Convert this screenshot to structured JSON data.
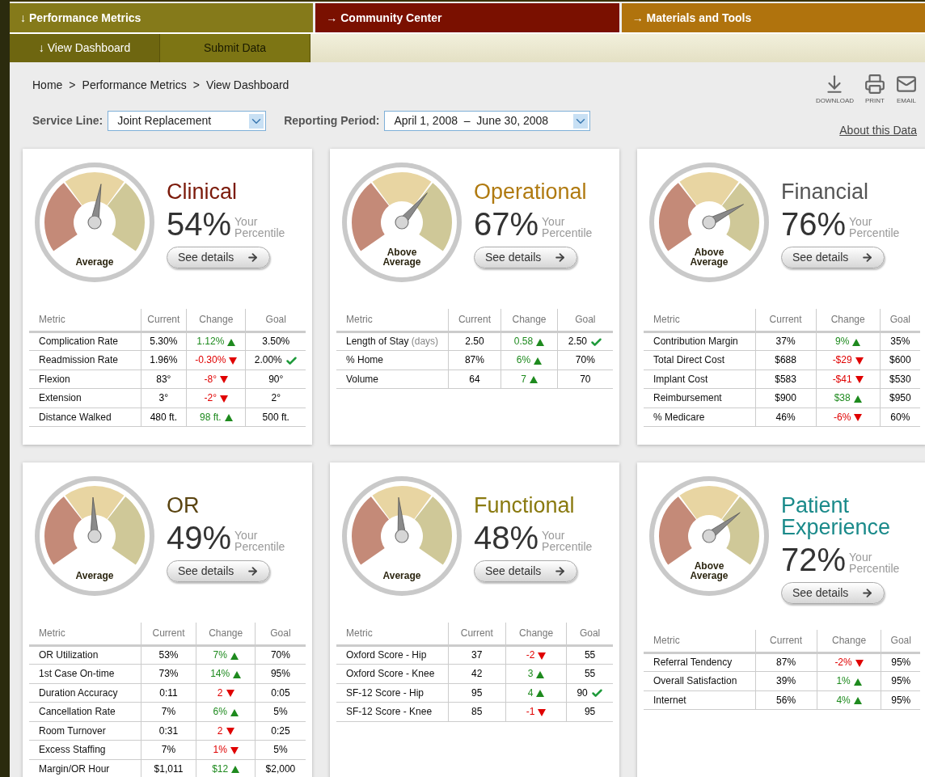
{
  "nav": {
    "tabs": [
      {
        "label": "↓ Performance Metrics",
        "color": "#857a1a"
      },
      {
        "label": "→ Community Center",
        "color": "#7a1000"
      },
      {
        "label": "→ Materials and Tools",
        "color": "#b0730d"
      }
    ],
    "subtabs": [
      {
        "label": "↓ View Dashboard",
        "selected": true
      },
      {
        "label": "Submit Data",
        "selected": false
      }
    ]
  },
  "breadcrumb": {
    "items": [
      "Home",
      "Performance Metrics",
      "View Dashboard"
    ],
    "separator": ">"
  },
  "tools": [
    {
      "kind": "download",
      "label": "DOWNLOAD"
    },
    {
      "kind": "print",
      "label": "PRINT"
    },
    {
      "kind": "email",
      "label": "EMAIL"
    }
  ],
  "filters": [
    {
      "label": "Service Line:",
      "value": "Joint Replacement"
    },
    {
      "label": "Reporting Period:",
      "value": "April 1, 2008  –  June 30, 2008"
    }
  ],
  "about_link": "About this Data",
  "cards": [
    {
      "title": "Clinical",
      "color": "#7b1a0a",
      "percent": "54%",
      "percentile_label": "Your Percentile",
      "level": 0.54,
      "rating": "Average",
      "button": "See details",
      "columns": [
        "Metric",
        "Current",
        "Change",
        "Goal"
      ],
      "rows": [
        {
          "metric": "Complication Rate",
          "current": "5.30%",
          "change": "1.12%",
          "kind": "up",
          "goal": "3.50%",
          "goal_met": false
        },
        {
          "metric": "Readmission Rate",
          "current": "1.96%",
          "change": "-0.30%",
          "kind": "down",
          "goal": "2.00%",
          "goal_met": true
        },
        {
          "metric": "Flexion",
          "current": "83°",
          "change": "-8°",
          "kind": "down",
          "goal": "90°",
          "goal_met": false
        },
        {
          "metric": "Extension",
          "current": "3°",
          "change": "-2°",
          "kind": "down",
          "goal": "2°",
          "goal_met": false
        },
        {
          "metric": "Distance Walked",
          "current": "480 ft.",
          "change": "98 ft.",
          "kind": "up",
          "goal": "500 ft.",
          "goal_met": false
        }
      ]
    },
    {
      "title": "Operational",
      "color": "#b07a10",
      "percent": "67%",
      "percentile_label": "Your Percentile",
      "level": 0.67,
      "rating": "Above Average",
      "button": "See details",
      "columns": [
        "Metric",
        "Current",
        "Change",
        "Goal"
      ],
      "rows": [
        {
          "metric": "Length of Stay",
          "unit": "(days)",
          "current": "2.50",
          "change": "0.58",
          "kind": "up",
          "goal": "2.50",
          "goal_met": true
        },
        {
          "metric": "% Home",
          "current": "87%",
          "change": "6%",
          "kind": "up",
          "goal": "70%",
          "goal_met": false
        },
        {
          "metric": "Volume",
          "current": "64",
          "change": "7",
          "kind": "up",
          "goal": "70",
          "goal_met": false
        }
      ]
    },
    {
      "title": "Financial",
      "color": "#555555",
      "percent": "76%",
      "percentile_label": "Your Percentile",
      "level": 0.76,
      "rating": "Above Average",
      "button": "See details",
      "columns": [
        "Metric",
        "Current",
        "Change",
        "Goal"
      ],
      "rows": [
        {
          "metric": "Contribution Margin",
          "current": "37%",
          "change": "9%",
          "kind": "up",
          "goal": "35%",
          "goal_met": false
        },
        {
          "metric": "Total Direct Cost",
          "current": "$688",
          "change": "-$29",
          "kind": "down",
          "goal": "$600",
          "goal_met": false
        },
        {
          "metric": "Implant Cost",
          "current": "$583",
          "change": "-$41",
          "kind": "down",
          "goal": "$530",
          "goal_met": false
        },
        {
          "metric": "Reimbursement",
          "current": "$900",
          "change": "$38",
          "kind": "up",
          "goal": "$950",
          "goal_met": false
        },
        {
          "metric": "% Medicare",
          "current": "46%",
          "change": "-6%",
          "kind": "down",
          "goal": "60%",
          "goal_met": false
        }
      ]
    },
    {
      "title": "OR",
      "color": "#5a4410",
      "percent": "49%",
      "percentile_label": "Your Percentile",
      "level": 0.49,
      "rating": "Average",
      "button": "See details",
      "columns": [
        "Metric",
        "Current",
        "Change",
        "Goal"
      ],
      "rows": [
        {
          "metric": "OR Utilization",
          "current": "53%",
          "change": "7%",
          "kind": "up",
          "goal": "70%",
          "goal_met": false
        },
        {
          "metric": "1st Case On-time",
          "current": "73%",
          "change": "14%",
          "kind": "up",
          "goal": "95%",
          "goal_met": false
        },
        {
          "metric": "Duration Accuracy",
          "current": "0:11",
          "change": "2",
          "kind": "down",
          "goal": "0:05",
          "goal_met": false
        },
        {
          "metric": "Cancellation Rate",
          "current": "7%",
          "change": "6%",
          "kind": "up",
          "goal": "5%",
          "goal_met": false
        },
        {
          "metric": "Room Turnover",
          "current": "0:31",
          "change": "2",
          "kind": "down",
          "goal": "0:25",
          "goal_met": false
        },
        {
          "metric": "Excess Staffing",
          "current": "7%",
          "change": "1%",
          "kind": "down",
          "goal": "5%",
          "goal_met": false
        },
        {
          "metric": "Margin/OR Hour",
          "current": "$1,011",
          "change": "$12",
          "kind": "up",
          "goal": "$2,000",
          "goal_met": false
        }
      ]
    },
    {
      "title": "Functional",
      "color": "#8a7a10",
      "percent": "48%",
      "percentile_label": "Your Percentile",
      "level": 0.48,
      "rating": "Average",
      "button": "See details",
      "columns": [
        "Metric",
        "Current",
        "Change",
        "Goal"
      ],
      "rows": [
        {
          "metric": "Oxford Score - Hip",
          "current": "37",
          "change": "-2",
          "kind": "down",
          "goal": "55",
          "goal_met": false
        },
        {
          "metric": "Oxford Score - Knee",
          "current": "42",
          "change": "3",
          "kind": "up",
          "goal": "55",
          "goal_met": false
        },
        {
          "metric": "SF-12 Score - Hip",
          "current": "95",
          "change": "4",
          "kind": "up",
          "goal": "90",
          "goal_met": true
        },
        {
          "metric": "SF-12 Score - Knee",
          "current": "85",
          "change": "-1",
          "kind": "down",
          "goal": "95",
          "goal_met": false
        }
      ]
    },
    {
      "title": "Patient Experience",
      "color": "#1a8a8a",
      "percent": "72%",
      "percentile_label": "Your Percentile",
      "level": 0.72,
      "rating": "Above Average",
      "button": "See details",
      "columns": [
        "Metric",
        "Current",
        "Change",
        "Goal"
      ],
      "rows": [
        {
          "metric": "Referral Tendency",
          "current": "87%",
          "change": "-2%",
          "kind": "down",
          "goal": "95%",
          "goal_met": false
        },
        {
          "metric": "Overall Satisfaction",
          "current": "39%",
          "change": "1%",
          "kind": "up",
          "goal": "95%",
          "goal_met": false
        },
        {
          "metric": "Internet",
          "current": "56%",
          "change": "4%",
          "kind": "up",
          "goal": "95%",
          "goal_met": false
        }
      ]
    }
  ]
}
